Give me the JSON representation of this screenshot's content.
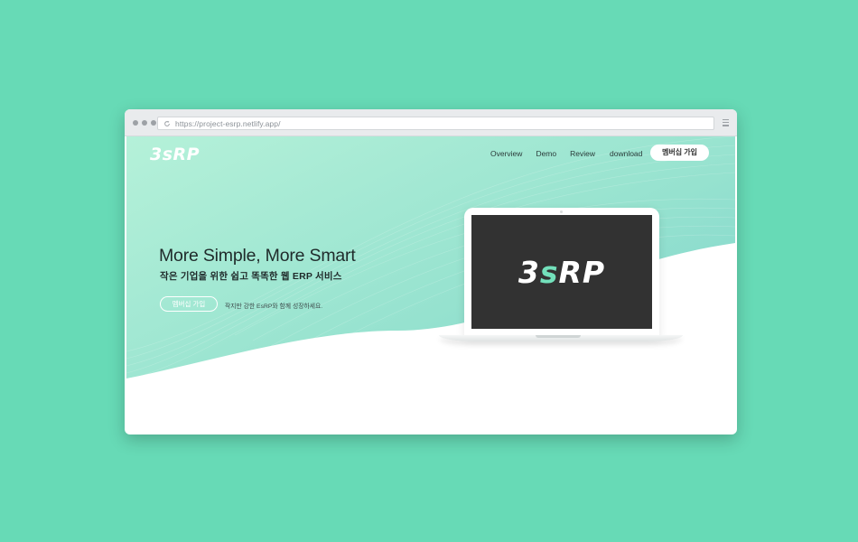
{
  "browser": {
    "url": "https://project-esrp.netlify.app/"
  },
  "site": {
    "logo": "3sRP",
    "nav": [
      "Overview",
      "Demo",
      "Review",
      "download"
    ],
    "join_button": "멤버십 가입"
  },
  "hero": {
    "headline": "More Simple, More Smart",
    "subhead": "작은 기업을 위한 쉽고 똑똑한 웹 ERP 서비스",
    "cta_button": "멤버십 가입",
    "cta_note": "작지만 강한 EsRP와 함께 성장하세요."
  },
  "laptop": {
    "screen_logo_pre": "3",
    "screen_logo_accent": "s",
    "screen_logo_post": "RP"
  },
  "colors": {
    "background": "#67dab6",
    "accent": "#73e0bb",
    "hero_gradient_start": "#b5f1d9",
    "hero_gradient_end": "#82d6cf"
  }
}
